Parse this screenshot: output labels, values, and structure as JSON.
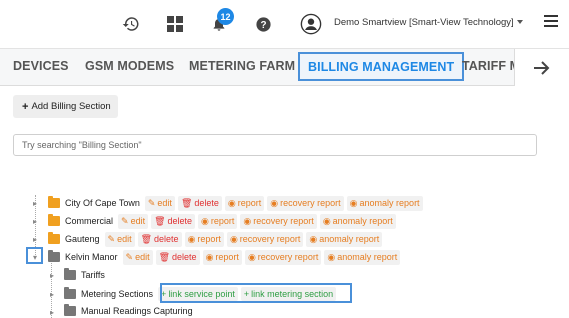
{
  "header": {
    "notification_count": "12",
    "user_label": "Demo Smartview [Smart-View Technology]",
    "icons": [
      "history-icon",
      "grid-icon",
      "bell-icon",
      "help-icon",
      "avatar-icon",
      "hamburger-menu-icon"
    ]
  },
  "tabs": [
    {
      "label": "DEVICES",
      "active": false
    },
    {
      "label": "GSM MODEMS",
      "active": false
    },
    {
      "label": "METERING FARM",
      "active": false
    },
    {
      "label": "BILLING MANAGEMENT",
      "active": true
    },
    {
      "label": "TARIFF M",
      "active": false
    }
  ],
  "toolbar": {
    "add_label": "Add Billing Section"
  },
  "search": {
    "placeholder": "Try searching \"Billing Section\""
  },
  "actions": {
    "edit": "edit",
    "delete": "delete",
    "report": "report",
    "recovery_report": "recovery report",
    "anomaly_report": "anomaly report",
    "link_service_point": "link service point",
    "link_metering_section": "link metering section"
  },
  "tree": {
    "city_of_cape_town": "City Of Cape Town",
    "commercial": "Commercial",
    "gauteng": "Gauteng",
    "kelvin_manor": "Kelvin Manor",
    "tariffs": "Tariffs",
    "metering_sections": "Metering Sections",
    "manual_readings_capturing": "Manual Readings Capturing"
  },
  "colors": {
    "accent": "#1e88e5",
    "edit": "#e67e22",
    "delete": "#e03131",
    "link": "#2f9e44",
    "folder": "#f0a020",
    "highlight": "#4a90d9"
  }
}
